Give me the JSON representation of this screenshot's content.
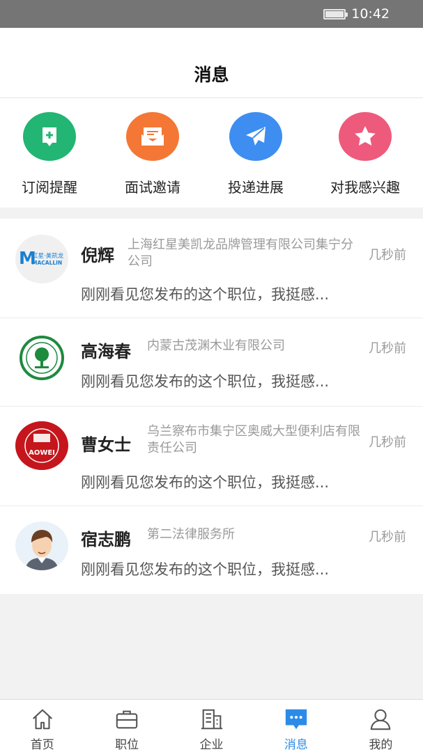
{
  "status": {
    "time": "10:42"
  },
  "header": {
    "title": "消息"
  },
  "quick_actions": [
    {
      "label": "订阅提醒",
      "icon": "subscribe-icon",
      "color": "#22b573"
    },
    {
      "label": "面试邀请",
      "icon": "mail-icon",
      "color": "#f47735"
    },
    {
      "label": "投递进展",
      "icon": "send-icon",
      "color": "#3d8ef0"
    },
    {
      "label": "对我感兴趣",
      "icon": "star-icon",
      "color": "#ee5a7c"
    }
  ],
  "messages": [
    {
      "name": "倪辉",
      "company": "上海红星美凯龙品牌管理有限公司集宁分公司",
      "time": "几秒前",
      "preview": "刚刚看见您发布的这个职位，我挺感...",
      "avatar_text": "红星·美凯龙",
      "avatar_sub": "MACALLIN"
    },
    {
      "name": "高海春",
      "company": "内蒙古茂渊木业有限公司",
      "time": "几秒前",
      "preview": "刚刚看见您发布的这个职位，我挺感..."
    },
    {
      "name": "曹女士",
      "company": "乌兰察布市集宁区奥威大型便利店有限责任公司",
      "time": "几秒前",
      "preview": "刚刚看见您发布的这个职位，我挺感...",
      "avatar_text": "AOWEI"
    },
    {
      "name": "宿志鹏",
      "company": "第二法律服务所",
      "time": "几秒前",
      "preview": "刚刚看见您发布的这个职位，我挺感..."
    }
  ],
  "tabs": [
    {
      "label": "首页",
      "icon": "home-icon"
    },
    {
      "label": "职位",
      "icon": "briefcase-icon"
    },
    {
      "label": "企业",
      "icon": "building-icon"
    },
    {
      "label": "消息",
      "icon": "chat-icon",
      "active": true
    },
    {
      "label": "我的",
      "icon": "user-icon"
    }
  ],
  "colors": {
    "accent": "#2a8be8",
    "status_bar": "#757575"
  }
}
